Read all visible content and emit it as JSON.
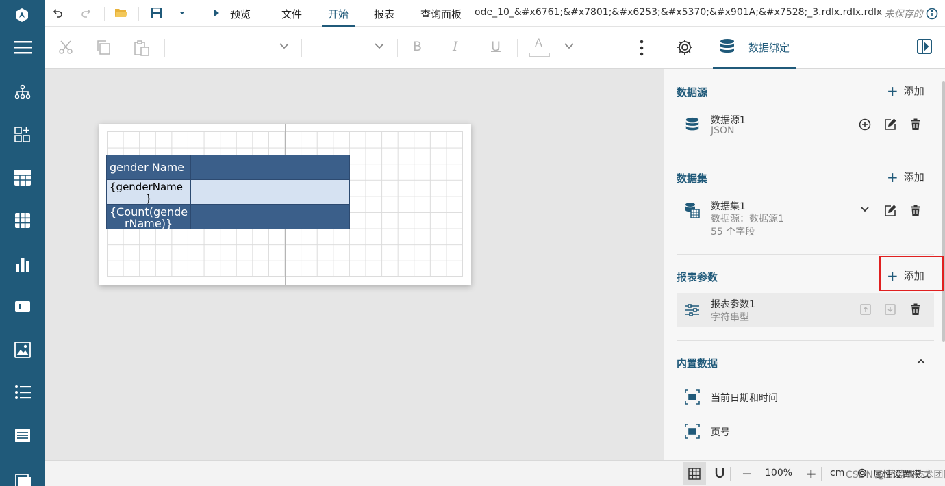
{
  "menubar": {
    "preview_label": "预览",
    "tabs": [
      {
        "label": "文件"
      },
      {
        "label": "开始"
      },
      {
        "label": "报表"
      },
      {
        "label": "查询面板"
      }
    ],
    "active_tab": "开始",
    "filename": "ode_10_&#x6761;&#x7801;&#x6253;&#x5370;&#x901A;&#x7528;_3.rdlx.rdlx.rdlx",
    "unsaved": "* 未保存的"
  },
  "toolbar": {
    "bold_label": "B",
    "italic_label": "I",
    "underline_label": "U",
    "font_color_label": "A",
    "databind_label": "数据绑定"
  },
  "report": {
    "header_cell": "gender Name",
    "detail_cell_line1": "{genderName",
    "detail_cell_line2": "}",
    "total_cell_line1": "{Count(gende",
    "total_cell_line2": "rName)}"
  },
  "panel": {
    "datasource": {
      "title": "数据源",
      "add_label": "添加",
      "items": [
        {
          "name": "数据源1",
          "type": "JSON"
        }
      ]
    },
    "dataset": {
      "title": "数据集",
      "add_label": "添加",
      "items": [
        {
          "name": "数据集1",
          "source": "数据源：数据源1",
          "fields": "55 个字段"
        }
      ]
    },
    "params": {
      "title": "报表参数",
      "add_label": "添加",
      "items": [
        {
          "name": "报表参数1",
          "type": "字符串型"
        }
      ]
    },
    "builtin": {
      "title": "内置数据",
      "items": [
        {
          "name": "当前日期和时间"
        },
        {
          "name": "页号"
        }
      ]
    }
  },
  "statusbar": {
    "zoom": "100%",
    "unit": "cm",
    "watermark": "CSDN @葡萄城技术团队",
    "mode": "属性设置模式"
  },
  "colors": {
    "sidebar": "#205a7a",
    "accent": "#205a7a",
    "header_fill": "#3b5f8a",
    "detail_fill": "#d6e2f2",
    "highlight": "#e02020"
  }
}
